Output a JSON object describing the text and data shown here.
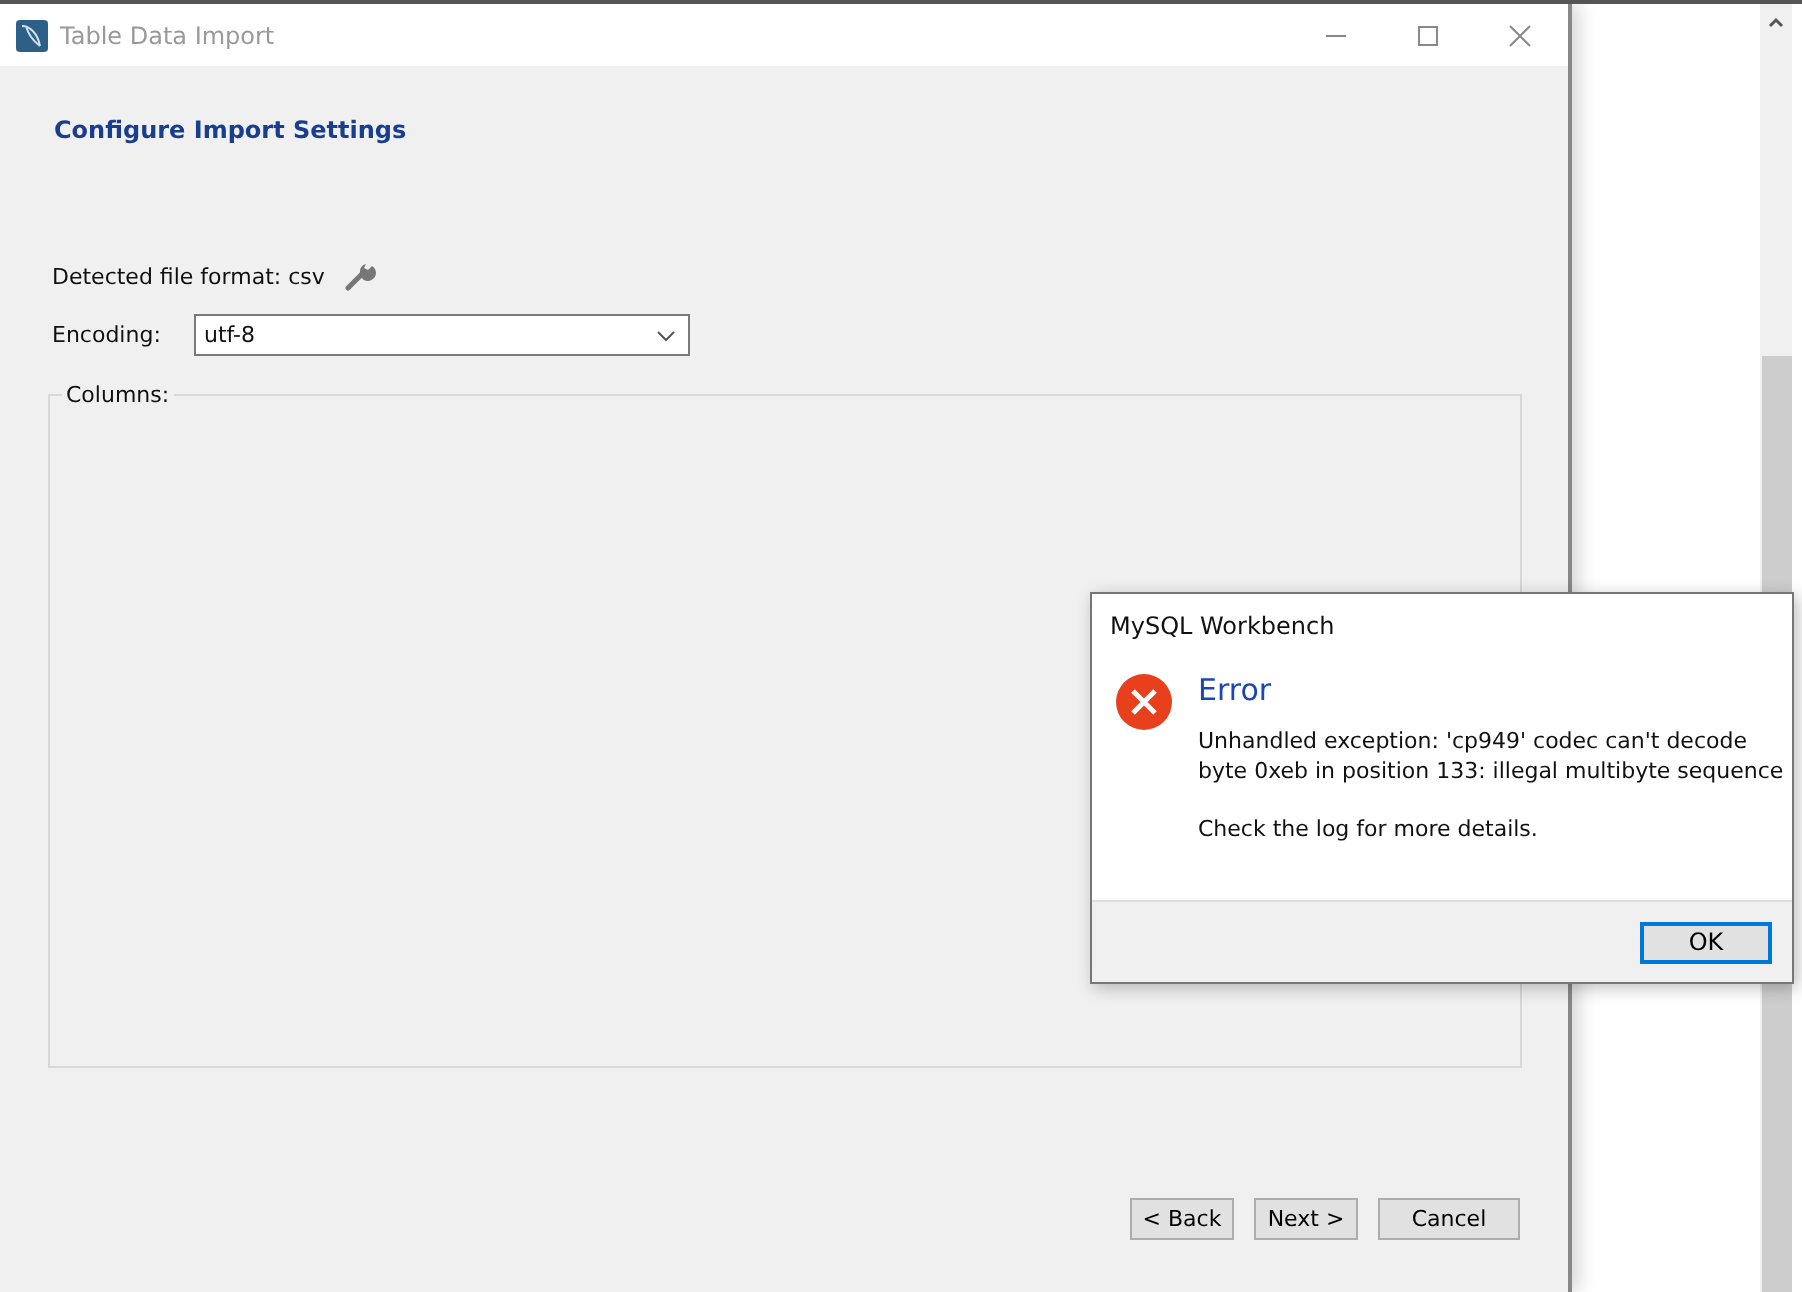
{
  "window": {
    "title": "Table Data Import"
  },
  "heading": "Configure Import Settings",
  "format": {
    "label": "Detected file format: csv"
  },
  "encoding": {
    "label": "Encoding:",
    "value": "utf-8"
  },
  "columns": {
    "label": "Columns:"
  },
  "buttons": [
    {
      "label": "< Back"
    },
    {
      "label": "Next >"
    },
    {
      "label": "Cancel"
    }
  ],
  "dialog": {
    "title": "MySQL Workbench",
    "heading": "Error",
    "message": [
      "Unhandled exception: 'cp949' codec can't decode",
      "byte 0xeb in position 133: illegal multibyte sequence"
    ],
    "note": "Check the log for more details.",
    "buttons": [
      {
        "label": "OK",
        "default": true
      }
    ]
  }
}
